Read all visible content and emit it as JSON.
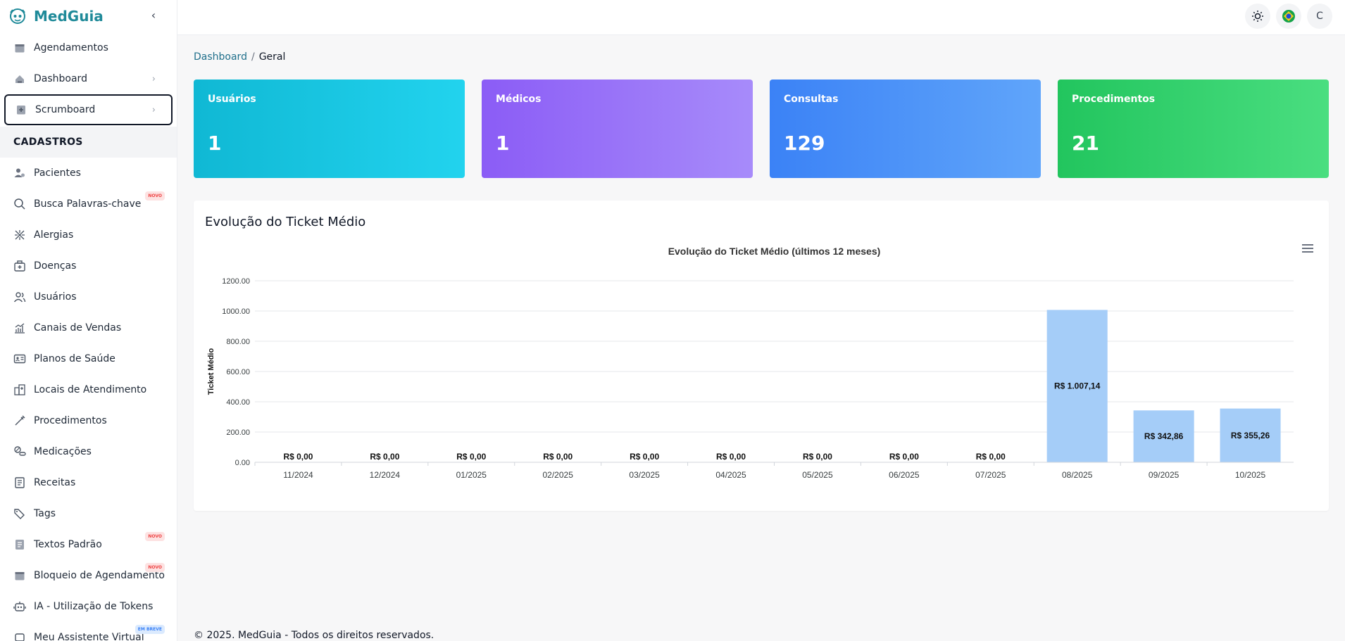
{
  "brand": {
    "name": "MedGuia"
  },
  "sidebar": {
    "items_top": [
      {
        "label": "Agendamentos",
        "icon": "calendar-icon"
      },
      {
        "label": "Dashboard",
        "icon": "dashboard-icon"
      },
      {
        "label": "Scrumboard",
        "icon": "scrumboard-icon"
      }
    ],
    "section": "CADASTROS",
    "items": [
      {
        "label": "Pacientes",
        "icon": "patients-icon"
      },
      {
        "label": "Busca Palavras-chave",
        "icon": "search-icon",
        "badge": "NOVO"
      },
      {
        "label": "Alergias",
        "icon": "allergy-icon"
      },
      {
        "label": "Doenças",
        "icon": "medical-kit-icon"
      },
      {
        "label": "Usuários",
        "icon": "users-icon"
      },
      {
        "label": "Canais de Vendas",
        "icon": "chart-icon"
      },
      {
        "label": "Planos de Saúde",
        "icon": "id-card-icon"
      },
      {
        "label": "Locais de Atendimento",
        "icon": "hospital-icon"
      },
      {
        "label": "Procedimentos",
        "icon": "syringe-icon"
      },
      {
        "label": "Medicações",
        "icon": "pill-icon"
      },
      {
        "label": "Receitas",
        "icon": "document-icon"
      },
      {
        "label": "Tags",
        "icon": "tag-icon"
      },
      {
        "label": "Textos Padrão",
        "icon": "text-icon",
        "badge": "NOVO"
      },
      {
        "label": "Bloqueio de Agendamento",
        "icon": "calendar-block-icon",
        "badge": "NOVO"
      },
      {
        "label": "IA - Utilização de Tokens",
        "icon": "robot-icon"
      },
      {
        "label": "Meu Assistente Virtual",
        "icon": "assistant-icon",
        "badge": "EM BREVE"
      }
    ]
  },
  "topbar": {
    "avatar": "C",
    "theme_icon": "sun-icon",
    "language_icon": "brazil-flag-icon"
  },
  "breadcrumb": {
    "parent": "Dashboard",
    "separator": "/",
    "current": "Geral"
  },
  "cards": [
    {
      "label": "Usuários",
      "value": "1",
      "gradient": [
        "#10b8d4",
        "#22d3ee"
      ]
    },
    {
      "label": "Médicos",
      "value": "1",
      "gradient": [
        "#8b5cf6",
        "#a78bfa"
      ]
    },
    {
      "label": "Consultas",
      "value": "129",
      "gradient": [
        "#3b82f6",
        "#60a5fa"
      ]
    },
    {
      "label": "Procedimentos",
      "value": "21",
      "gradient": [
        "#22c55e",
        "#4ade80"
      ]
    }
  ],
  "panel": {
    "title": "Evolução do Ticket Médio"
  },
  "chart_data": {
    "type": "bar",
    "title": "Evolução do Ticket Médio (últimos 12 meses)",
    "xlabel": "",
    "ylabel": "Ticket Médio",
    "categories": [
      "11/2024",
      "12/2024",
      "01/2025",
      "02/2025",
      "03/2025",
      "04/2025",
      "05/2025",
      "06/2025",
      "07/2025",
      "08/2025",
      "09/2025",
      "10/2025"
    ],
    "values": [
      0,
      0,
      0,
      0,
      0,
      0,
      0,
      0,
      0,
      1007.14,
      342.86,
      355.26
    ],
    "data_labels": [
      "R$ 0,00",
      "R$ 0,00",
      "R$ 0,00",
      "R$ 0,00",
      "R$ 0,00",
      "R$ 0,00",
      "R$ 0,00",
      "R$ 0,00",
      "R$ 0,00",
      "R$ 1.007,14",
      "R$ 342,86",
      "R$ 355,26"
    ],
    "yticks": [
      "0.00",
      "200.00",
      "400.00",
      "600.00",
      "800.00",
      "1000.00",
      "1200.00"
    ],
    "ylim": [
      0,
      1200
    ],
    "bar_color": "#a5cdf8",
    "grid": true
  },
  "footer": {
    "text": "© 2025. MedGuia - Todos os direitos reservados."
  }
}
